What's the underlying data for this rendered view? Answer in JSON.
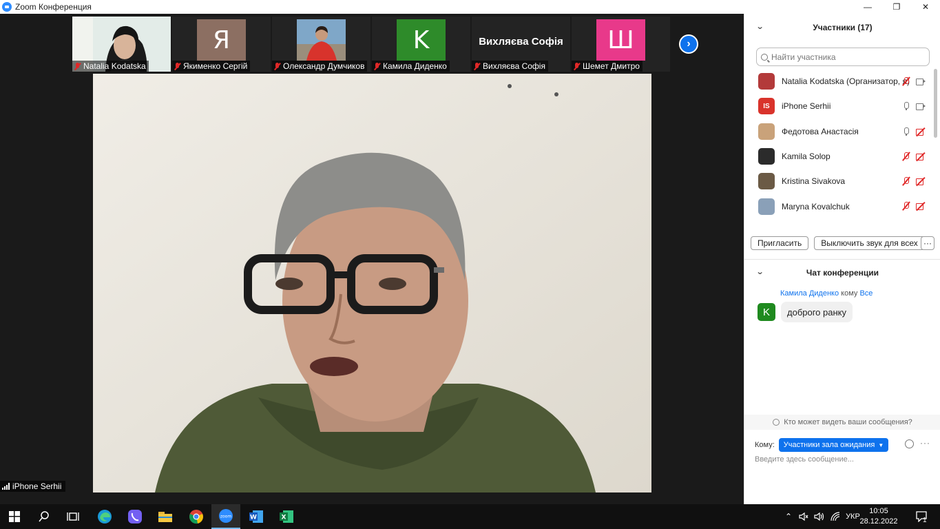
{
  "window": {
    "title": "Zoom Конференция",
    "minimize": "—",
    "maximize": "❐",
    "close": "✕"
  },
  "thumbnails": [
    {
      "name": "Natalia Kodatska",
      "type": "video"
    },
    {
      "name": "Якименко Сергій",
      "initial": "Я",
      "color": "#8c6f62"
    },
    {
      "name": "Олександр Думчиков",
      "type": "video"
    },
    {
      "name": "Камила Диденко",
      "initial": "K",
      "color": "#2e8b2a"
    },
    {
      "name": "Вихляєва Софія",
      "bigname": "Вихляєва Софія"
    },
    {
      "name": "Шемет Дмитро",
      "initial": "Ш",
      "color": "#e8398a"
    }
  ],
  "thumb_next": "›",
  "speaker": {
    "name": "iPhone Serhii"
  },
  "participants_panel": {
    "title": "Участники (17)",
    "search_placeholder": "Найти участника",
    "items": [
      {
        "name": "Natalia Kodatska (Организатор, я)",
        "avatar": "",
        "avatar_color": "#b33a3a",
        "mic": "muted",
        "cam": "on"
      },
      {
        "name": "iPhone Serhii",
        "avatar": "IS",
        "avatar_color": "#d9332b",
        "mic": "on",
        "cam": "on"
      },
      {
        "name": "Федотова Анастасія",
        "avatar": "",
        "avatar_color": "#c9a27a",
        "mic": "on",
        "cam": "off"
      },
      {
        "name": "Kamila Solop",
        "avatar": "",
        "avatar_color": "#2b2b2b",
        "mic": "muted",
        "cam": "off"
      },
      {
        "name": "Kristina Sivakova",
        "avatar": "",
        "avatar_color": "#6b5a45",
        "mic": "muted",
        "cam": "off"
      },
      {
        "name": "Maryna Kovalchuk",
        "avatar": "",
        "avatar_color": "#8aa0b8",
        "mic": "muted",
        "cam": "off"
      }
    ],
    "invite_label": "Пригласить",
    "mute_all_label": "Выключить звук для всех",
    "more_label": "···"
  },
  "chat_panel": {
    "title": "Чат конференции",
    "messages": [
      {
        "sender": "Камила Диденко",
        "to_word": "кому",
        "recipient": "Все",
        "avatar": "K",
        "text": "доброго ранку"
      }
    ],
    "who_sees": "Кто может видеть ваши сообщения?",
    "to_label": "Кому:",
    "to_value": "Участники зала ожидания",
    "input_placeholder": "Введите здесь сообщение...",
    "more_label": "···"
  },
  "taskbar": {
    "lang": "УКР",
    "time": "10:05",
    "date": "28.12.2022",
    "notifications": "1"
  }
}
